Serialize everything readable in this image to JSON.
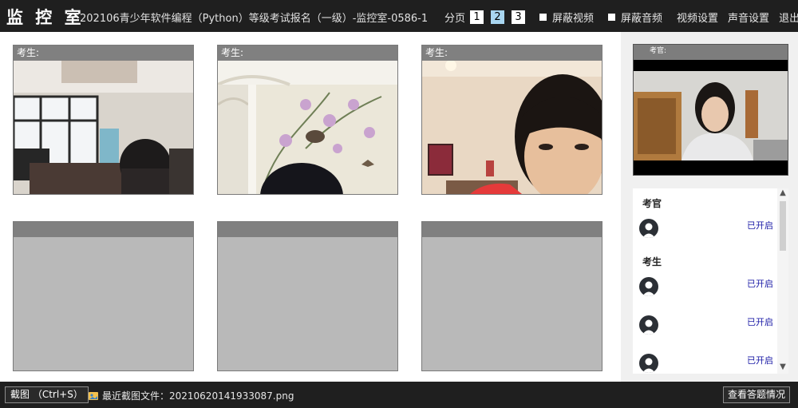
{
  "header": {
    "logo": "监 控 室",
    "room_title": "202106青少年软件编程（Python）等级考试报名（一级）-监控室-0586-1",
    "pager": {
      "label": "分页",
      "pages": [
        "1",
        "2",
        "3"
      ],
      "active": "2"
    },
    "menu": {
      "mute_video": "屏蔽视频",
      "mute_audio": "屏蔽音频",
      "video_settings": "视频设置",
      "audio_settings": "声音设置",
      "exit": "退出"
    }
  },
  "tiles": [
    {
      "label": "考生:",
      "has_video": true
    },
    {
      "label": "考生:",
      "has_video": true
    },
    {
      "label": "考生:",
      "has_video": true
    },
    {
      "label": "",
      "has_video": false
    },
    {
      "label": "",
      "has_video": false
    },
    {
      "label": "",
      "has_video": false
    }
  ],
  "proctor": {
    "label": "考官:"
  },
  "roster": {
    "proctor_group": "考官",
    "student_group": "考生",
    "proctor_status": "已开启",
    "student_statuses": [
      "已开启",
      "已开启",
      "已开启"
    ]
  },
  "footer": {
    "screenshot_button": "截图 （Ctrl+S）",
    "recent_screenshot": "最近截图文件：20210620141933087.png",
    "view_answers_button": "查看答题情况"
  },
  "colors": {
    "bar": "#1f1f1f",
    "tile_header": "#808080",
    "tile_empty": "#b9b9b9",
    "status_link": "#1a1aa6",
    "active_page": "#a9d6f0"
  }
}
